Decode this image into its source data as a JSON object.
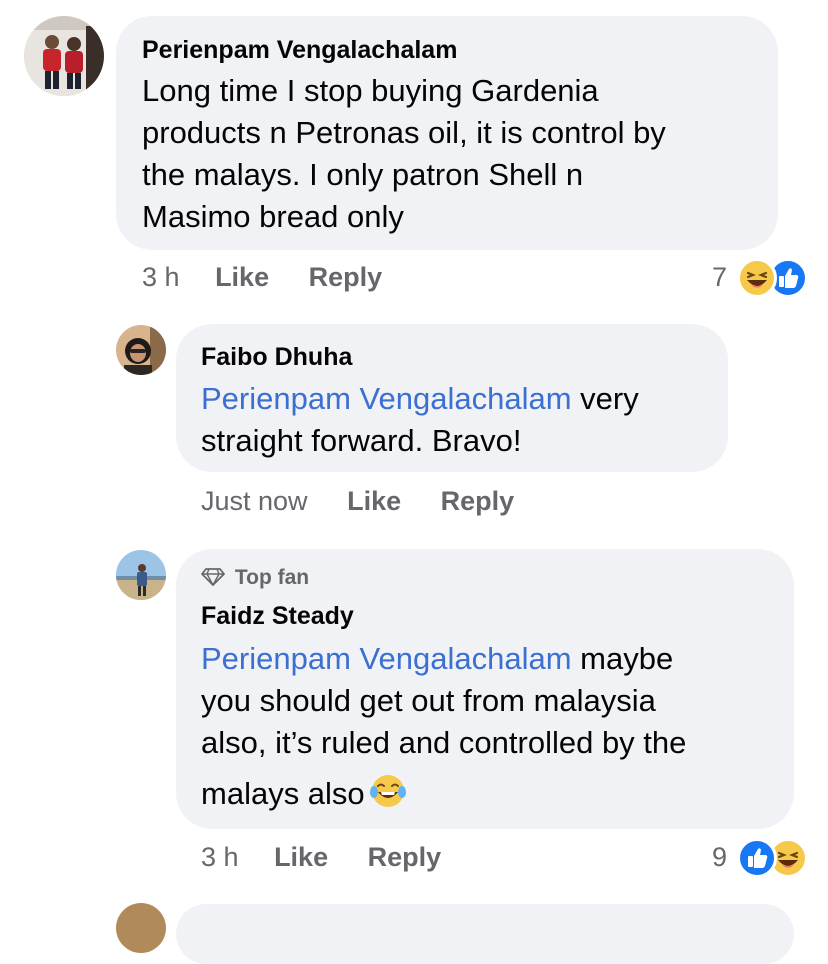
{
  "comments": [
    {
      "author": "Perienpam Vengalachalam",
      "text": "Long time I stop buying Gardenia products n Petronas oil, it is control by the malays. I only patron Shell n Masimo bread only",
      "lines": [
        "Long time I stop buying Gardenia",
        "products n Petronas oil, it is control by",
        "the malays. I only patron Shell n",
        "Masimo bread only"
      ],
      "time": "3 h",
      "like_label": "Like",
      "reply_label": "Reply",
      "reaction_count": "7",
      "reactions": [
        "haha-icon",
        "like-icon"
      ]
    },
    {
      "author": "Faibo Dhuha",
      "mention": "Perienpam Vengalachalam",
      "line1_rest": " very",
      "line2": "straight forward. Bravo!",
      "time": "Just now",
      "like_label": "Like",
      "reply_label": "Reply"
    },
    {
      "badge": "Top fan",
      "badge_icon": "diamond-icon",
      "author": "Faidz Steady",
      "mention": "Perienpam Vengalachalam",
      "line1_rest": " maybe",
      "line2": "you should get out from malaysia",
      "line3": "also, it’s ruled and controlled by the",
      "line4": "malays also",
      "inline_emoji": "tears-of-joy-icon",
      "time": "3 h",
      "like_label": "Like",
      "reply_label": "Reply",
      "reaction_count": "9",
      "reactions": [
        "like-icon",
        "haha-icon"
      ]
    }
  ],
  "colors": {
    "bubble": "#f0f2f5",
    "mention": "#3b6fd1",
    "meta": "#65676b",
    "like": "#1877f2",
    "haha": "#f7c94b"
  }
}
